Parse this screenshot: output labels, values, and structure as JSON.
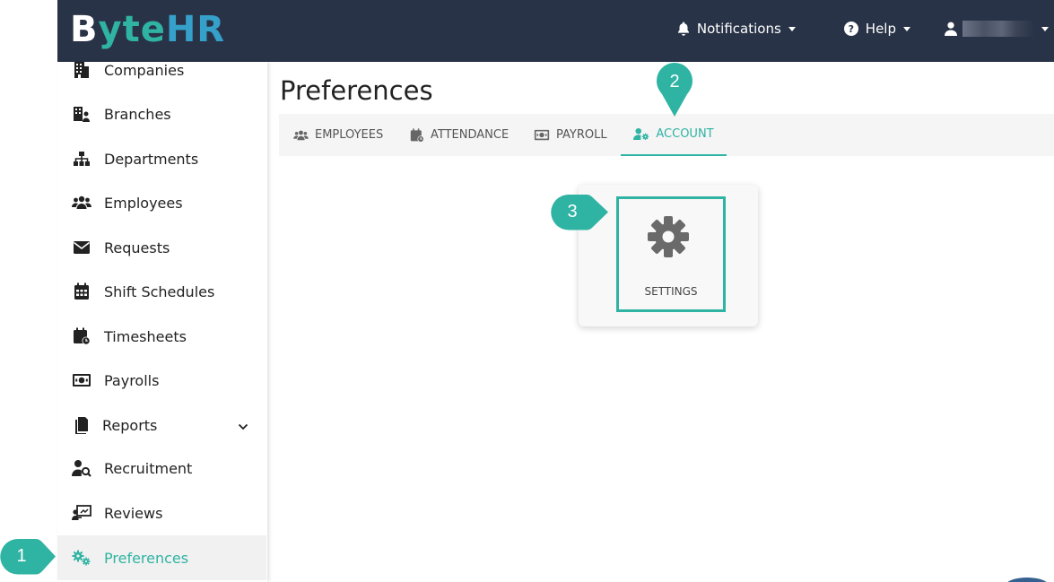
{
  "brand": {
    "logo_text_1": "B",
    "logo_text_2": "yte",
    "logo_text_3": "HR",
    "colors": {
      "topbar": "#293347",
      "accent": "#2fb3a3",
      "accent_blue": "#35a0c9"
    }
  },
  "topnav": {
    "notifications_label": "Notifications",
    "help_label": "Help",
    "help_icon": "?"
  },
  "sidebar": {
    "items": [
      {
        "label": "Companies",
        "icon": "building-icon"
      },
      {
        "label": "Branches",
        "icon": "branches-icon"
      },
      {
        "label": "Departments",
        "icon": "sitemap-icon"
      },
      {
        "label": "Employees",
        "icon": "users-icon"
      },
      {
        "label": "Requests",
        "icon": "envelope-icon"
      },
      {
        "label": "Shift Schedules",
        "icon": "calendar-icon"
      },
      {
        "label": "Timesheets",
        "icon": "calendar-clock-icon"
      },
      {
        "label": "Payrolls",
        "icon": "money-icon"
      },
      {
        "label": "Reports",
        "icon": "file-icon",
        "expandable": true
      },
      {
        "label": "Recruitment",
        "icon": "user-search-icon"
      },
      {
        "label": "Reviews",
        "icon": "presentation-icon"
      },
      {
        "label": "Preferences",
        "icon": "gears-icon",
        "active": true
      }
    ]
  },
  "main": {
    "title": "Preferences",
    "tabs": [
      {
        "label": "EMPLOYEES",
        "icon": "users-icon"
      },
      {
        "label": "ATTENDANCE",
        "icon": "calendar-clock-icon"
      },
      {
        "label": "PAYROLL",
        "icon": "money-icon"
      },
      {
        "label": "ACCOUNT",
        "icon": "user-gear-icon",
        "active": true
      }
    ],
    "card": {
      "label": "SETTINGS",
      "icon": "gear-icon"
    }
  },
  "callouts": {
    "step1": "1",
    "step2": "2",
    "step3": "3"
  }
}
